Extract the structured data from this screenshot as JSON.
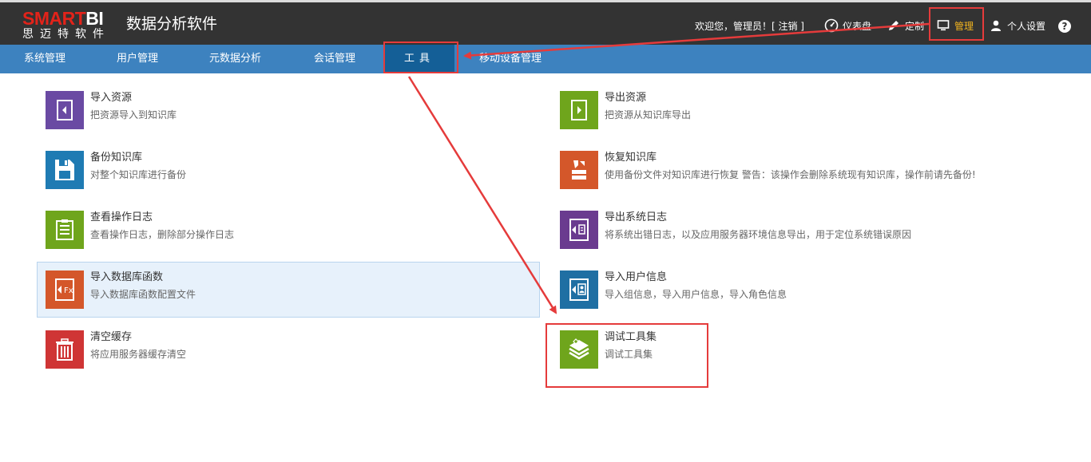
{
  "header": {
    "logo_text_a": "SMART",
    "logo_text_b": "BI",
    "logo_sub": "思迈特软件",
    "app_title": "数据分析软件",
    "welcome": "欢迎您，管理员！[ 注销 ]",
    "nav": {
      "dashboard": "仪表盘",
      "customize": "定制",
      "manage": "管理",
      "personal": "个人设置",
      "help": "?"
    }
  },
  "menu": {
    "items": [
      "系统管理",
      "用户管理",
      "元数据分析",
      "会话管理",
      "工具",
      "移动设备管理"
    ],
    "active_index": 4
  },
  "tools": {
    "left": [
      {
        "title": "导入资源",
        "desc": "把资源导入到知识库",
        "icon": "import-resource-icon",
        "color": "#6a4aa3"
      },
      {
        "title": "备份知识库",
        "desc": "对整个知识库进行备份",
        "icon": "backup-icon",
        "color": "#1f7bb3"
      },
      {
        "title": "查看操作日志",
        "desc": "查看操作日志，删除部分操作日志",
        "icon": "log-view-icon",
        "color": "#6fa51c"
      },
      {
        "title": "导入数据库函数",
        "desc": "导入数据库函数配置文件",
        "icon": "db-function-icon",
        "color": "#d4572a"
      },
      {
        "title": "清空缓存",
        "desc": "将应用服务器缓存清空",
        "icon": "trash-icon",
        "color": "#cf3535"
      }
    ],
    "right": [
      {
        "title": "导出资源",
        "desc": "把资源从知识库导出",
        "icon": "export-resource-icon",
        "color": "#6fa51c"
      },
      {
        "title": "恢复知识库",
        "desc": "使用备份文件对知识库进行恢复 警告：该操作会删除系统现有知识库，操作前请先备份!",
        "icon": "restore-icon",
        "color": "#d4572a"
      },
      {
        "title": "导出系统日志",
        "desc": "将系统出错日志，以及应用服务器环境信息导出，用于定位系统错误原因",
        "icon": "export-log-icon",
        "color": "#6a3b8f"
      },
      {
        "title": "导入用户信息",
        "desc": "导入组信息，导入用户信息，导入角色信息",
        "icon": "import-user-icon",
        "color": "#1f6fa3"
      },
      {
        "title": "调试工具集",
        "desc": "调试工具集",
        "icon": "debug-tools-icon",
        "color": "#6fa51c"
      }
    ]
  },
  "colors": {
    "header_bg": "#333333",
    "menu_bg": "#3d82bf",
    "menu_active": "#145f97",
    "annotation": "#e53b3b",
    "active_text": "#f3b51f"
  }
}
